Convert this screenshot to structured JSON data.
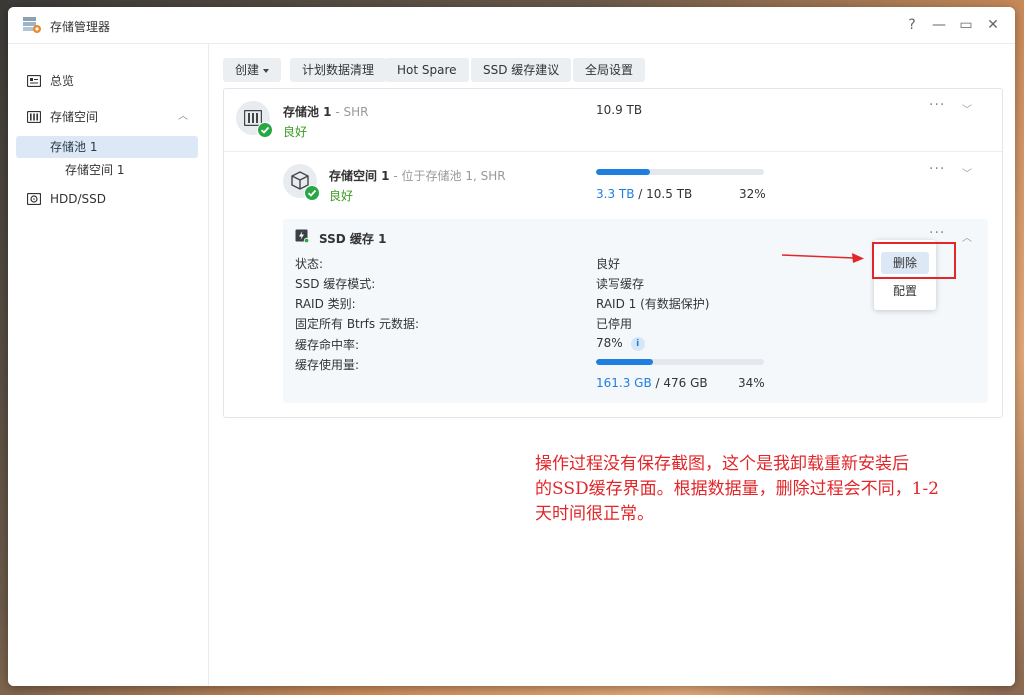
{
  "window": {
    "title": "存储管理器",
    "controls": [
      "?",
      "—",
      "▭",
      "✕"
    ]
  },
  "sidebar": {
    "items": [
      {
        "label": "总览",
        "icon": "overview-icon"
      },
      {
        "label": "存储空间",
        "icon": "storage-icon",
        "expanded": true
      },
      {
        "label": "存储池 1",
        "active": true
      },
      {
        "label": "存储空间 1"
      },
      {
        "label": "HDD/SSD",
        "icon": "disk-icon"
      }
    ]
  },
  "toolbar": {
    "create": "创建",
    "scheduled_scrub": "计划数据清理",
    "hot_spare": "Hot Spare",
    "ssd_advisor": "SSD 缓存建议",
    "global_settings": "全局设置"
  },
  "pool": {
    "name": "存储池 1",
    "type": "- SHR",
    "status": "良好",
    "size": "10.9 TB"
  },
  "volume": {
    "name": "存储空间 1",
    "location": "- 位于存储池 1, SHR",
    "status": "良好",
    "used": "3.3 TB",
    "total": "/ 10.5 TB",
    "percent": "32%",
    "fill": 0.32
  },
  "ssd_cache": {
    "name": "SSD 缓存 1",
    "rows": [
      {
        "label": "状态:",
        "value": "良好"
      },
      {
        "label": "SSD 缓存模式:",
        "value": "读写缓存"
      },
      {
        "label": "RAID 类别:",
        "value": "RAID 1 (有数据保护)"
      },
      {
        "label": "固定所有 Btrfs 元数据:",
        "value": "已停用"
      },
      {
        "label": "缓存命中率:",
        "value": "78%"
      },
      {
        "label": "缓存使用量:",
        "value": ""
      }
    ],
    "usage_used": "161.3 GB",
    "usage_total": "/ 476 GB",
    "usage_percent": "34%",
    "usage_fill": 0.34
  },
  "context_menu": {
    "delete": "删除",
    "configure": "配置"
  },
  "annotation": {
    "line1": "操作过程没有保存截图，这个是我卸载重新安装后",
    "line2": "的SSD缓存界面。根据数据量，删除过程会不同，1-2",
    "line3": "天时间很正常。"
  },
  "colors": {
    "accent": "#1f7ee0",
    "good": "#3a9d23",
    "annotation": "#e2262a"
  }
}
